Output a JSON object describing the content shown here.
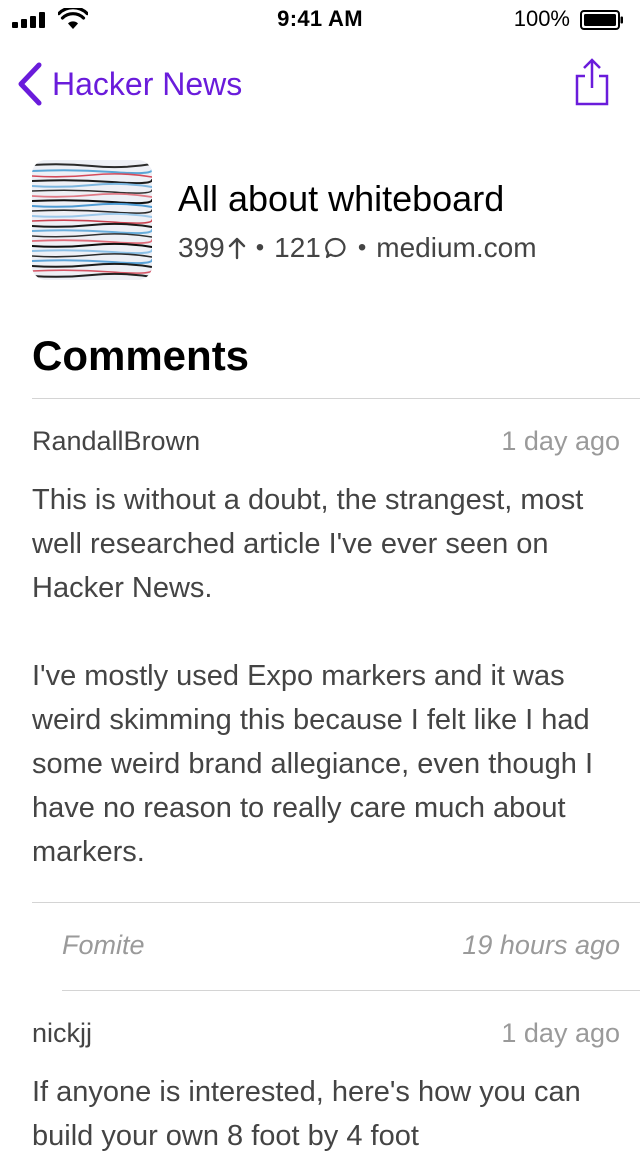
{
  "status_bar": {
    "time": "9:41 AM",
    "battery": "100%",
    "icons": [
      "signal-icon",
      "wifi-icon",
      "battery-icon"
    ]
  },
  "nav": {
    "back_label": "Hacker News",
    "back_icon": "chevron-left-icon",
    "share_icon": "share-icon",
    "accent_color": "#6a1cdb"
  },
  "story": {
    "title": "All about whiteboard",
    "points": "399",
    "points_icon": "arrow-up-icon",
    "comments": "121",
    "comments_icon": "speech-bubble-icon",
    "domain": "medium.com"
  },
  "comments_section": {
    "title": "Comments",
    "items": [
      {
        "author": "RandallBrown",
        "time": "1 day ago",
        "paragraphs": [
          "This is without a doubt, the strangest, most well researched article I've ever seen on Hacker News.",
          "I've mostly used Expo markers and it was weird skimming this because I felt like I had some weird brand allegiance, even though I have no reason to really care much about markers."
        ]
      },
      {
        "author": "Fomite",
        "time": "19 hours ago"
      },
      {
        "author": "nickjj",
        "time": "1 day ago",
        "paragraphs": [
          "If anyone is interested, here's how you can build your own 8 foot by 4 foot"
        ]
      }
    ]
  }
}
